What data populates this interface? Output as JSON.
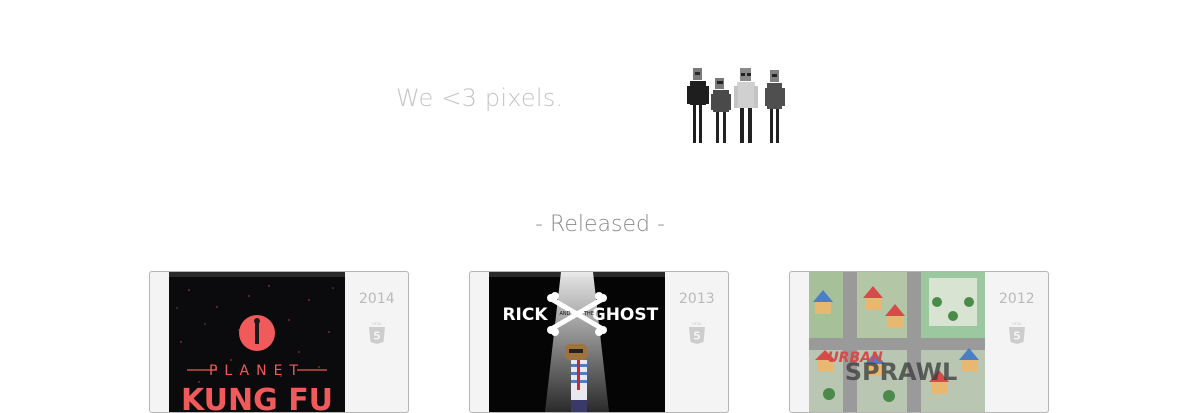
{
  "hero": {
    "tagline": "We <3 pixels.",
    "team_icon": "pixel-team-icon"
  },
  "released": {
    "heading": "- Released -",
    "games": [
      {
        "year": "2014",
        "thumb_text_top": "PLANET",
        "thumb_text_bottom": "KUNG FU",
        "badge_icon": "html5-icon"
      },
      {
        "year": "2013",
        "thumb_text_left": "RICK",
        "thumb_text_right": "GHOST",
        "thumb_small_top": "AND",
        "thumb_small_right": "THE",
        "badge_icon": "html5-icon"
      },
      {
        "year": "2012",
        "thumb_text_top": "URBAN",
        "thumb_text_bottom": "SPRAWL",
        "badge_icon": "html5-icon"
      }
    ]
  },
  "colors": {
    "card_bg": "#f3f4f3",
    "card_border": "#b5b5b5",
    "muted_text": "#c4c4c4",
    "kungfu_accent": "#f05a5a"
  }
}
